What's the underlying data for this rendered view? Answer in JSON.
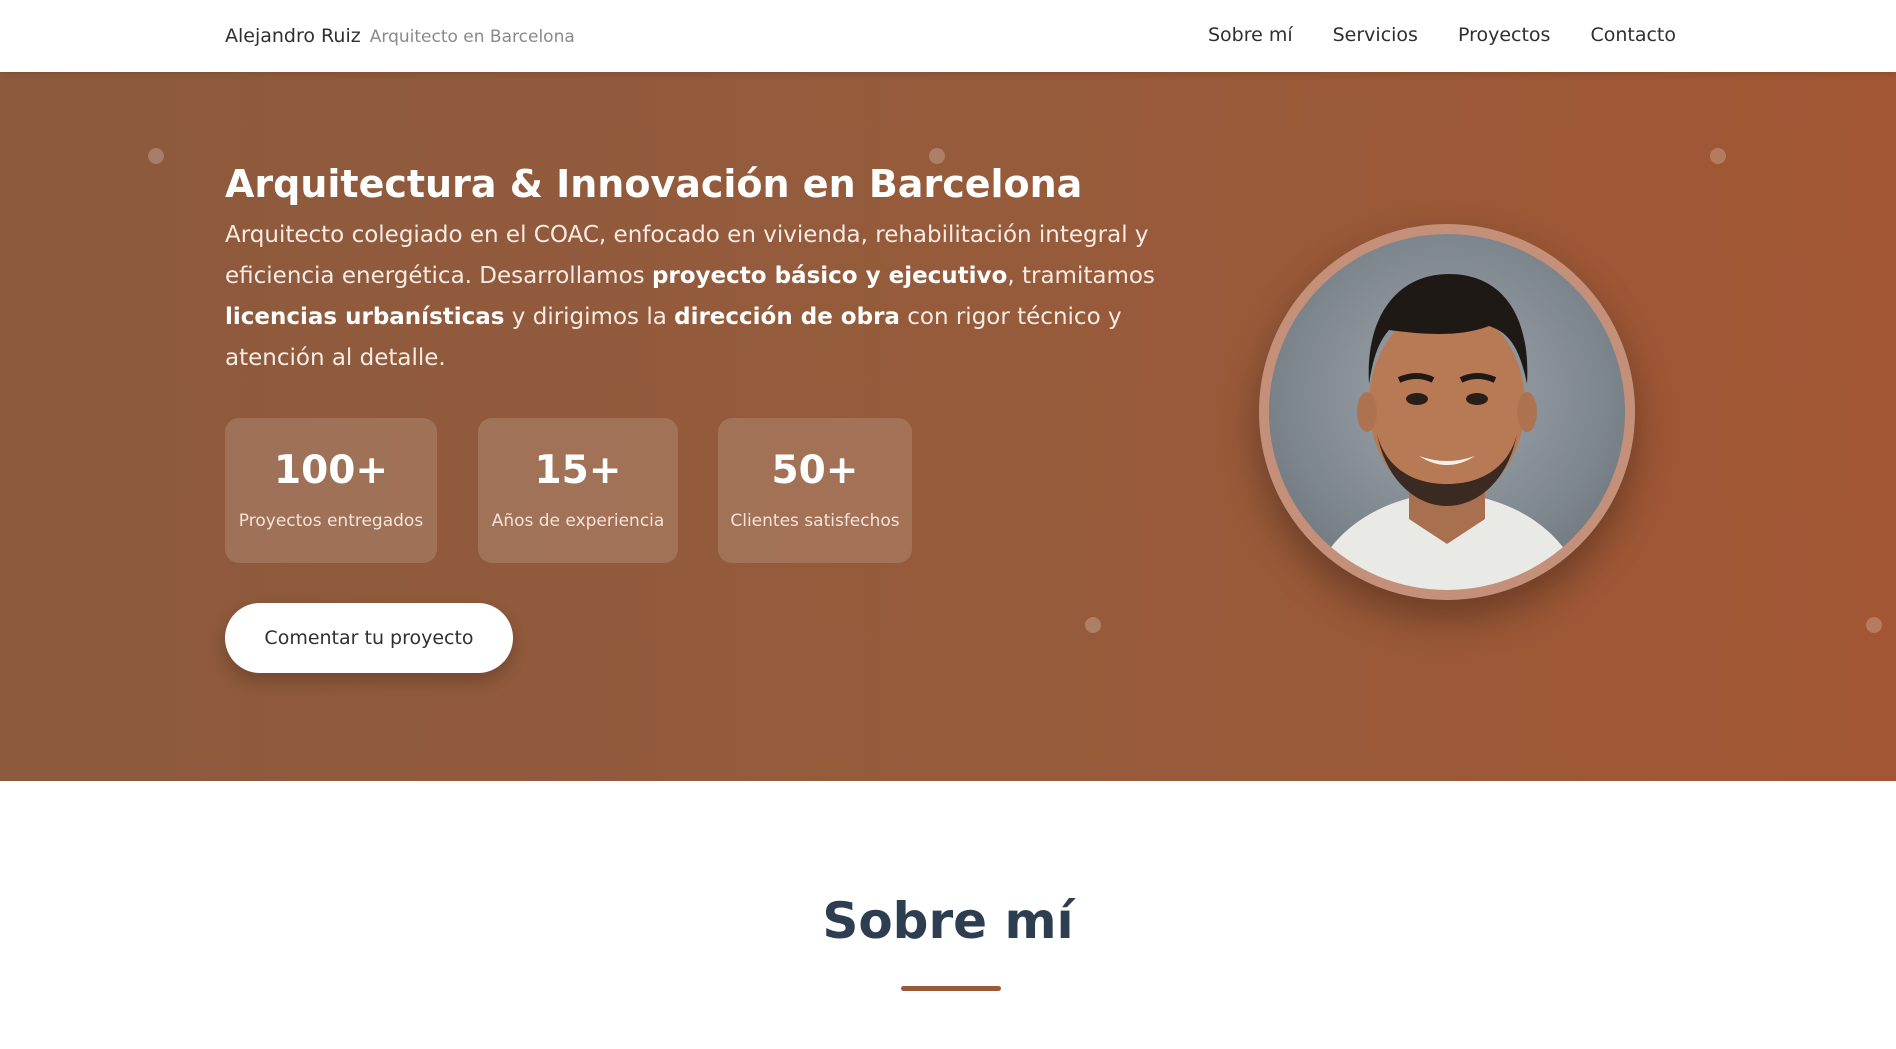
{
  "brand": {
    "name": "Alejandro Ruiz",
    "subtitle": "Arquitecto en Barcelona"
  },
  "nav": [
    {
      "label": "Sobre mí"
    },
    {
      "label": "Servicios"
    },
    {
      "label": "Proyectos"
    },
    {
      "label": "Contacto"
    }
  ],
  "hero": {
    "title": "Arquitectura & Innovación en Barcelona",
    "desc": {
      "p1": "Arquitecto colegiado en el COAC, enfocado en vivienda, rehabilitación integral y eficiencia energética. Desarrollamos ",
      "b1": "proyecto básico y ejecutivo",
      "p2": ", tramitamos ",
      "b2": "licencias urbanísticas",
      "p3": " y dirigimos la ",
      "b3": "dirección de obra",
      "p4": " con rigor técnico y atención al detalle."
    },
    "stats": [
      {
        "value": "100+",
        "label": "Proyectos entregados"
      },
      {
        "value": "15+",
        "label": "Años de experiencia"
      },
      {
        "value": "50+",
        "label": "Clientes satisfechos"
      }
    ],
    "cta_label": "Comentar tu proyecto"
  },
  "about": {
    "title": "Sobre mí"
  },
  "colors": {
    "hero_gradient_start": "#8d5a3d",
    "hero_gradient_end": "#a25633",
    "heading": "#2c3e50",
    "accent_line": "#9a5a3a",
    "portrait_border": "#c4907a"
  }
}
